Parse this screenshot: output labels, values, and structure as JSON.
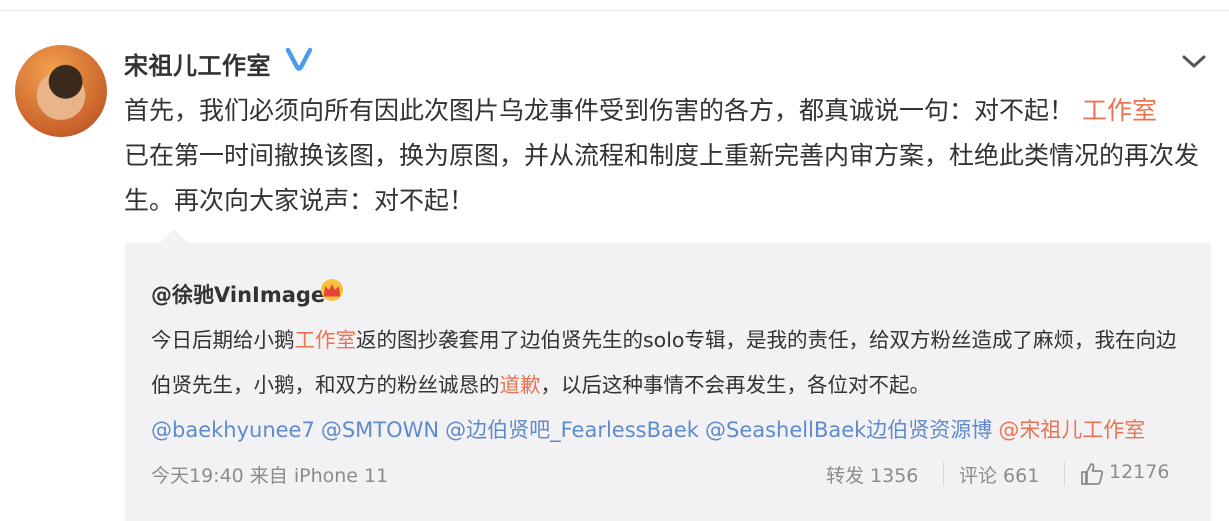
{
  "post": {
    "author": "宋祖儿工作室",
    "text_part1": "首先，我们必须向所有因此次图片乌龙事件受到伤害的各方，都真诚说一句：对不起！",
    "text_link": "工作室",
    "text_part2": "已在第一时间撤换该图，换为原图，并从流程和制度上重新完善内审方案，杜绝此类情况的再次发生。再次向大家说声：对不起！"
  },
  "repost": {
    "author": "@徐驰VinImage",
    "text_a": "今日后期给小鹅",
    "link_a": "工作室",
    "text_b": "返的图抄袭套用了边伯贤先生的solo专辑，是我的责任，给双方粉丝造成了麻烦，我在向边伯贤先生，小鹅，和双方的粉丝诚恳的",
    "link_b": "道歉",
    "text_c": "，以后这种事情不会再发生，各位对不起。",
    "mentions": [
      "@baekhyunee7",
      "@SMTOWN",
      "@边伯贤吧_FearlessBaek",
      "@SeashellBaek边伯贤资源博"
    ],
    "mention_red": "@宋祖儿工作室",
    "time": "今天19:40 来自 iPhone 11",
    "repost_label": "转发 1356",
    "comment_label": "评论 661",
    "likes": "12176"
  },
  "colors": {
    "link_red": "#eb7350",
    "mention_blue": "#5d8bcb",
    "verified": "#4a9df0"
  },
  "icons": {
    "verified": "verified-badge-icon",
    "crown": "crown-icon",
    "chevron": "chevron-down-icon",
    "like": "thumbs-up-icon"
  }
}
